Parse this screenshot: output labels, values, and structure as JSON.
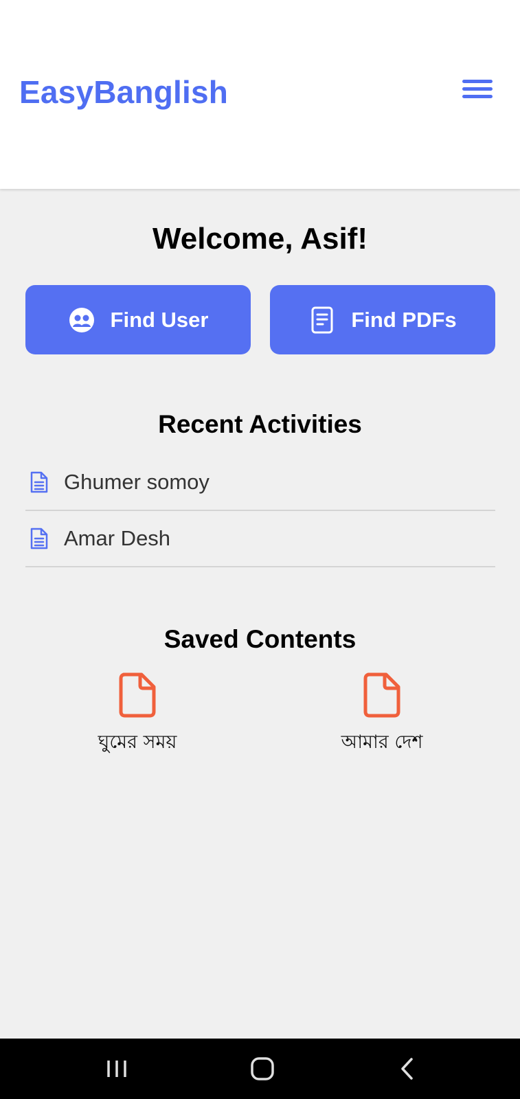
{
  "app": {
    "brand": "EasyBanglish",
    "brand_color": "#4f6ef2",
    "menu_icon": "hamburger-menu-icon"
  },
  "main": {
    "welcome": "Welcome, Asif!",
    "actions": [
      {
        "label": "Find User",
        "icon": "users-icon"
      },
      {
        "label": "Find PDFs",
        "icon": "document-icon"
      }
    ],
    "button_color": "#5570f2"
  },
  "recent": {
    "title": "Recent Activities",
    "items": [
      {
        "label": "Ghumer somoy",
        "icon": "file-text-icon"
      },
      {
        "label": "Amar Desh",
        "icon": "file-text-icon"
      }
    ]
  },
  "saved": {
    "title": "Saved Contents",
    "icon_color": "#f0603c",
    "items": [
      {
        "label": "ঘুমের সময়",
        "icon": "file-icon"
      },
      {
        "label": "আমার দেশ",
        "icon": "file-icon"
      }
    ]
  },
  "navbar": {
    "recents_icon": "recents-icon",
    "home_icon": "home-icon",
    "back_icon": "back-icon"
  }
}
